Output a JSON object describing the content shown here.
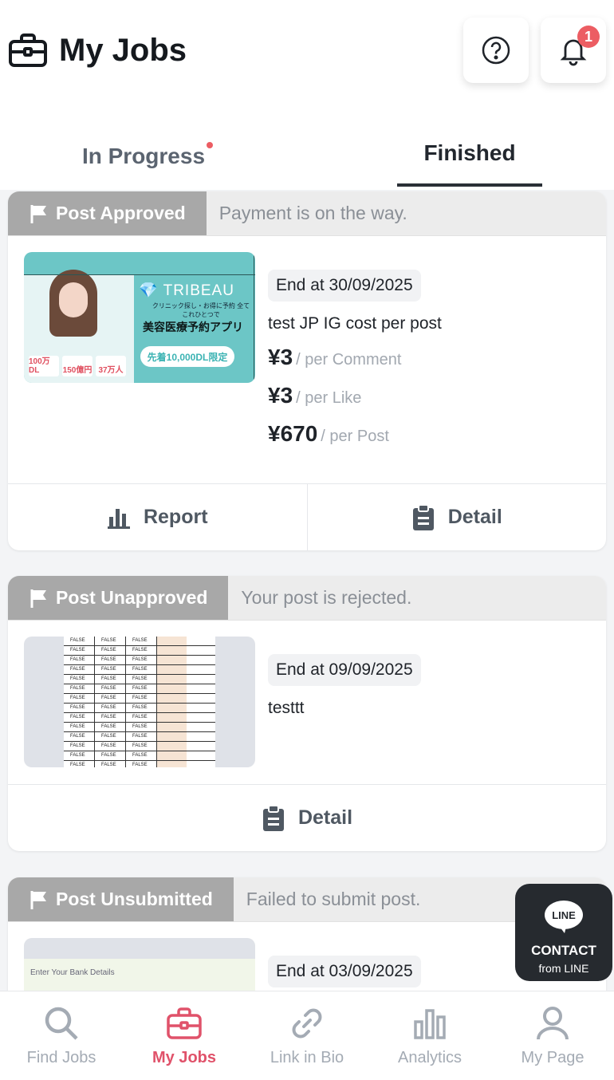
{
  "header": {
    "title": "My Jobs",
    "notification_count": "1"
  },
  "tabs": [
    {
      "label": "In Progress",
      "has_dot": true
    },
    {
      "label": "Finished",
      "active": true
    }
  ],
  "jobs": [
    {
      "status": "Post Approved",
      "message": "Payment is on the way.",
      "end": "End at 30/09/2025",
      "name": "test JP IG cost per post",
      "prices": [
        {
          "amount": "¥3",
          "unit": "/ per Comment"
        },
        {
          "amount": "¥3",
          "unit": "/ per Like"
        },
        {
          "amount": "¥670",
          "unit": "/ per Post"
        }
      ],
      "thumb": {
        "brand": "TRIBEAU",
        "sub": "クリニック探し・お得に予約 全てこれひとつで",
        "app": "美容医療予約アプリ",
        "pill": "先着10,000DL限定",
        "stats": [
          "100万DL",
          "150億円",
          "37万人"
        ]
      },
      "actions": [
        "Report",
        "Detail"
      ]
    },
    {
      "status": "Post Unapproved",
      "message": "Your post is rejected.",
      "end": "End at 09/09/2025",
      "name": "testtt",
      "sheet_cell": "FALSE",
      "actions": [
        "Detail"
      ]
    },
    {
      "status": "Post Unsubmitted",
      "message": "Failed to submit post.",
      "end": "End at 03/09/2025",
      "thumb_text": "Enter Your Bank Details"
    }
  ],
  "contact": {
    "logo": "LINE",
    "label": "CONTACT",
    "sub": "from LINE"
  },
  "nav": [
    {
      "label": "Find Jobs",
      "icon": "search-icon"
    },
    {
      "label": "My Jobs",
      "icon": "briefcase-icon",
      "active": true
    },
    {
      "label": "Link in Bio",
      "icon": "link-icon"
    },
    {
      "label": "Analytics",
      "icon": "bar-chart-icon"
    },
    {
      "label": "My Page",
      "icon": "user-icon"
    }
  ],
  "colors": {
    "accent": "#e0526a",
    "badge": "#ec5d63",
    "status_chip": "#a8a8a8",
    "line_bg": "#262a2f"
  }
}
